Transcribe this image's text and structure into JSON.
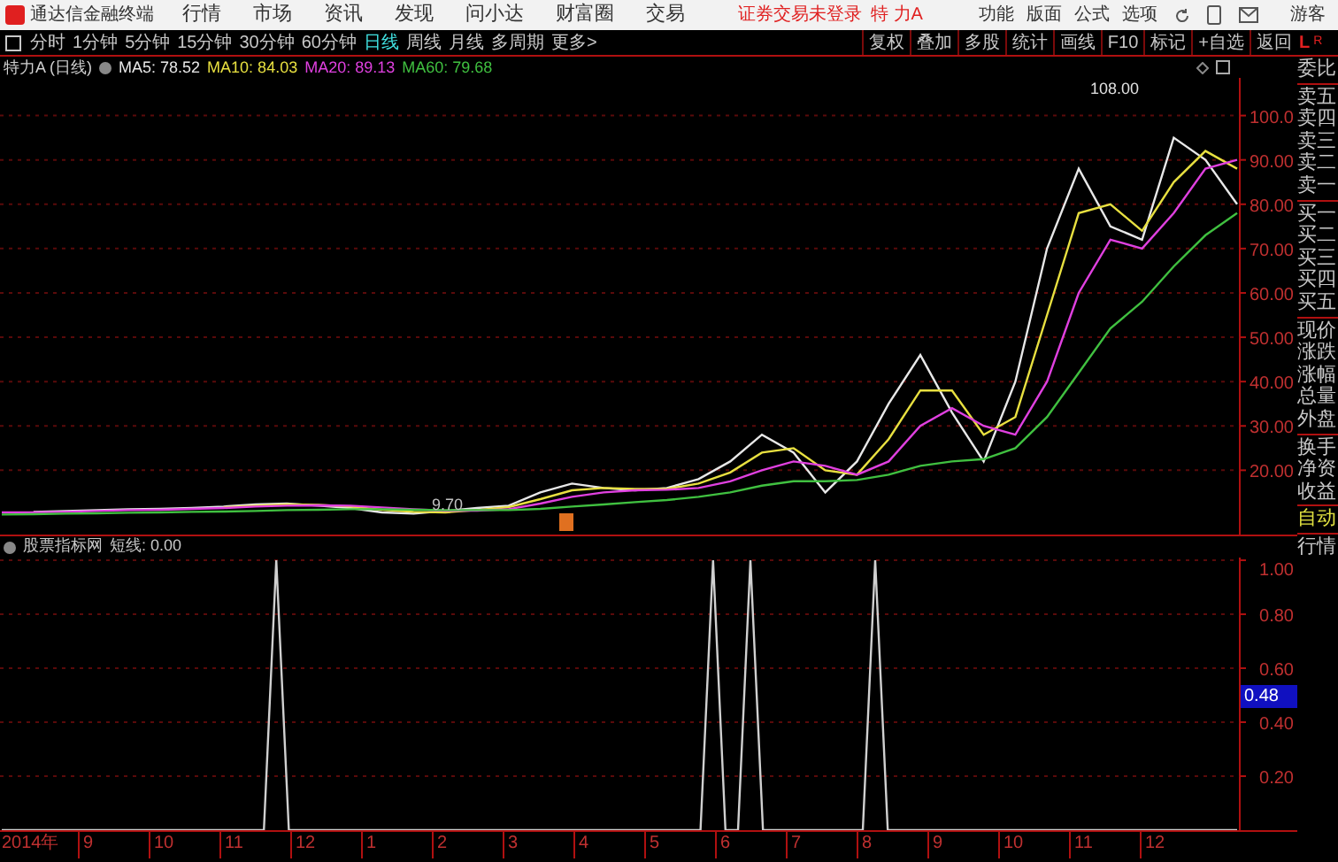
{
  "title_bar": {
    "app_name": "通达信金融终端",
    "menus": [
      "行情",
      "市场",
      "资讯",
      "发现",
      "问小达",
      "财富圈",
      "交易"
    ],
    "login_status": "证券交易未登录",
    "stock": "特 力A",
    "actions": [
      "功能",
      "版面",
      "公式",
      "选项"
    ],
    "user": "游客"
  },
  "toolbar": {
    "periods": [
      {
        "label": "分时",
        "selected": false
      },
      {
        "label": "1分钟",
        "selected": false
      },
      {
        "label": "5分钟",
        "selected": false
      },
      {
        "label": "15分钟",
        "selected": false
      },
      {
        "label": "30分钟",
        "selected": false
      },
      {
        "label": "60分钟",
        "selected": false
      },
      {
        "label": "日线",
        "selected": true
      },
      {
        "label": "周线",
        "selected": false
      },
      {
        "label": "月线",
        "selected": false
      },
      {
        "label": "多周期",
        "selected": false
      },
      {
        "label": "更多>",
        "selected": false
      }
    ],
    "tools": [
      "复权",
      "叠加",
      "多股",
      "统计",
      "画线",
      "F10",
      "标记",
      "+自选",
      "返回"
    ]
  },
  "panel_badge": {
    "left": "L",
    "right": "R"
  },
  "chart_header": {
    "stock": "特力A (日线)",
    "readings": [
      ": 78.52",
      ": 84.03",
      ": 89.13",
      ": 79.68"
    ]
  },
  "price_chart": {
    "max_label": "108.00",
    "min_label": "9.70",
    "chart_data": {
      "type": "line",
      "grid": true,
      "ylim": [
        5.5,
        108.5
      ],
      "yticks": [
        {
          "value": 100,
          "label": "100.0"
        },
        {
          "value": 90,
          "label": "90.00"
        },
        {
          "value": 80,
          "label": "80.00"
        },
        {
          "value": 70,
          "label": "70.00"
        },
        {
          "value": 60,
          "label": "60.00"
        },
        {
          "value": 50,
          "label": "50.00"
        },
        {
          "value": 40,
          "label": "40.00"
        },
        {
          "value": 30,
          "label": "30.00"
        },
        {
          "value": 20,
          "label": "20.00"
        }
      ],
      "series": [
        {
          "name": "MA5",
          "color": "#e8e8e8",
          "values": [
            null,
            10.6,
            10.8,
            11,
            11.2,
            11.3,
            11.5,
            11.8,
            12.3,
            12.5,
            12,
            11.5,
            10.5,
            10.2,
            10.8,
            11.5,
            12,
            15,
            17,
            16,
            15.5,
            16,
            18,
            22,
            28,
            24,
            15,
            22,
            35,
            46,
            33,
            22,
            40,
            70,
            88,
            75,
            72,
            95,
            90,
            80
          ]
        },
        {
          "name": "MA10",
          "color": "#e8e040",
          "values": [
            null,
            null,
            null,
            null,
            null,
            null,
            null,
            11.6,
            12,
            12.3,
            12.2,
            11.8,
            11.1,
            10.6,
            10.5,
            11,
            11.7,
            13.5,
            15.5,
            16,
            15.8,
            15.8,
            17,
            19.5,
            24,
            25,
            20,
            19,
            27,
            38,
            38,
            28,
            32,
            55,
            78,
            80,
            74,
            85,
            92,
            88
          ]
        },
        {
          "name": "MA20",
          "color": "#e040e0",
          "values": [
            10.5,
            10.5,
            10.6,
            10.8,
            11,
            11.1,
            11.3,
            11.5,
            11.8,
            12,
            12.1,
            12,
            11.6,
            11.2,
            10.9,
            10.9,
            11.2,
            12.5,
            14,
            15,
            15.5,
            15.6,
            16,
            17.5,
            20,
            22,
            21,
            19,
            22,
            30,
            34,
            30,
            28,
            40,
            60,
            72,
            70,
            78,
            88,
            90
          ]
        },
        {
          "name": "MA60",
          "color": "#40c040",
          "values": [
            10,
            10.1,
            10.2,
            10.3,
            10.4,
            10.5,
            10.6,
            10.7,
            10.8,
            11,
            11.1,
            11.2,
            11.2,
            11.1,
            11,
            11,
            11,
            11.3,
            11.8,
            12.3,
            12.8,
            13.3,
            14,
            15,
            16.5,
            17.5,
            17.5,
            17.8,
            19,
            21,
            22,
            22.5,
            25,
            32,
            42,
            52,
            58,
            66,
            73,
            78
          ]
        }
      ]
    }
  },
  "indicator": {
    "header": {
      "source": "股票指标网",
      "value": ": 0.00"
    },
    "cursor_value": "0.48",
    "chart_data": {
      "type": "line",
      "grid": true,
      "ylim": [
        0,
        1.01
      ],
      "series": [
        {
          "name": "短线",
          "color": "#d0d0d0",
          "values": [
            0,
            0,
            0,
            0,
            0,
            0,
            0,
            0,
            0,
            0,
            0,
            0,
            0,
            0,
            0,
            0,
            0,
            0,
            0,
            0,
            0,
            0,
            1,
            0,
            0,
            0,
            0,
            0,
            0,
            0,
            0,
            0,
            0,
            0,
            0,
            0,
            0,
            0,
            0,
            0,
            0,
            0,
            0,
            0,
            0,
            0,
            0,
            0,
            0,
            0,
            0,
            0,
            0,
            0,
            0,
            0,
            0,
            1,
            0,
            0,
            1,
            0,
            0,
            0,
            0,
            0,
            0,
            0,
            0,
            0,
            1,
            0,
            0,
            0,
            0,
            0,
            0,
            0,
            0,
            0,
            0,
            0,
            0,
            0,
            0,
            0,
            0,
            0,
            0,
            0,
            0,
            0,
            0,
            0,
            0,
            0,
            0,
            0,
            0,
            0
          ]
        }
      ],
      "yticks": [
        {
          "value": 1,
          "label": "1.00"
        },
        {
          "value": 0.8,
          "label": "0.80"
        },
        {
          "value": 0.6,
          "label": "0.60"
        },
        {
          "value": 0.4,
          "label": "0.40"
        },
        {
          "value": 0.2,
          "label": "0.20"
        }
      ]
    }
  },
  "time_axis": [
    "2014年",
    "9",
    "10",
    "11",
    "12",
    "1",
    "2",
    "3",
    "4",
    "5",
    "6",
    "7",
    "8",
    "9",
    "10",
    "11",
    "12"
  ],
  "side_panel": {
    "groups": [
      [
        "委比"
      ],
      [
        "卖五",
        "卖四",
        "卖三",
        "卖二",
        "卖一"
      ],
      [
        "买一",
        "买二",
        "买三",
        "买四",
        "买五"
      ],
      [
        "现价",
        "涨跌",
        "涨幅",
        "总量",
        "外盘"
      ],
      [
        "换手",
        "净资",
        "收益"
      ]
    ],
    "buttons": [
      "自动",
      "行情"
    ]
  }
}
